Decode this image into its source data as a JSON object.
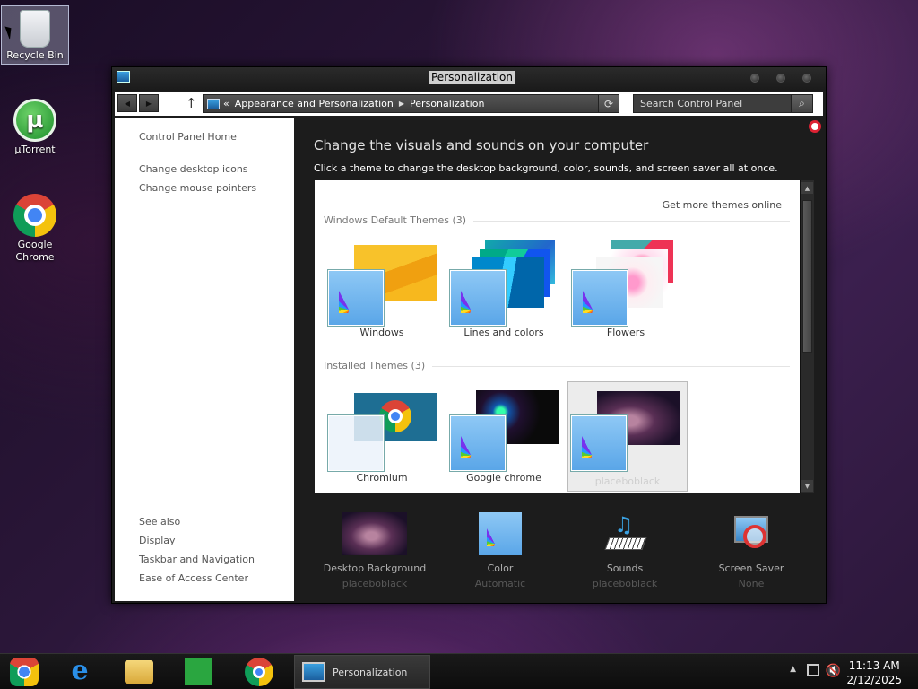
{
  "desktop": {
    "icons": [
      {
        "label": "Recycle Bin"
      },
      {
        "label": "µTorrent"
      },
      {
        "label": "Google Chrome"
      }
    ]
  },
  "window": {
    "title": "Personalization",
    "address": {
      "prefix": "«",
      "crumbs": [
        "Appearance and Personalization",
        "Personalization"
      ]
    },
    "search_placeholder": "Search Control Panel"
  },
  "sidebar": {
    "home": "Control Panel Home",
    "links": [
      "Change desktop icons",
      "Change mouse pointers"
    ],
    "see_also_heading": "See also",
    "see_also": [
      "Display",
      "Taskbar and Navigation",
      "Ease of Access Center"
    ]
  },
  "content": {
    "headline": "Change the visuals and sounds on your computer",
    "subline": "Click a theme to change the desktop background, color, sounds, and screen saver all at once.",
    "more_themes": "Get more themes online",
    "groups": [
      {
        "label": "Windows Default Themes (3)",
        "themes": [
          "Windows",
          "Lines and colors",
          "Flowers"
        ]
      },
      {
        "label": "Installed Themes (3)",
        "themes": [
          "Chromium",
          "Google chrome",
          "placeboblack"
        ]
      }
    ],
    "selected_theme": "placeboblack",
    "bottom": [
      {
        "label": "Desktop Background",
        "value": "placeboblack"
      },
      {
        "label": "Color",
        "value": "Automatic"
      },
      {
        "label": "Sounds",
        "value": "placeboblack"
      },
      {
        "label": "Screen Saver",
        "value": "None"
      }
    ]
  },
  "taskbar": {
    "task_label": "Personalization",
    "time": "11:13 AM",
    "date": "2/12/2025"
  },
  "colors": {
    "accent": "#5aa6e8",
    "window_bg": "#1c1c1c"
  }
}
